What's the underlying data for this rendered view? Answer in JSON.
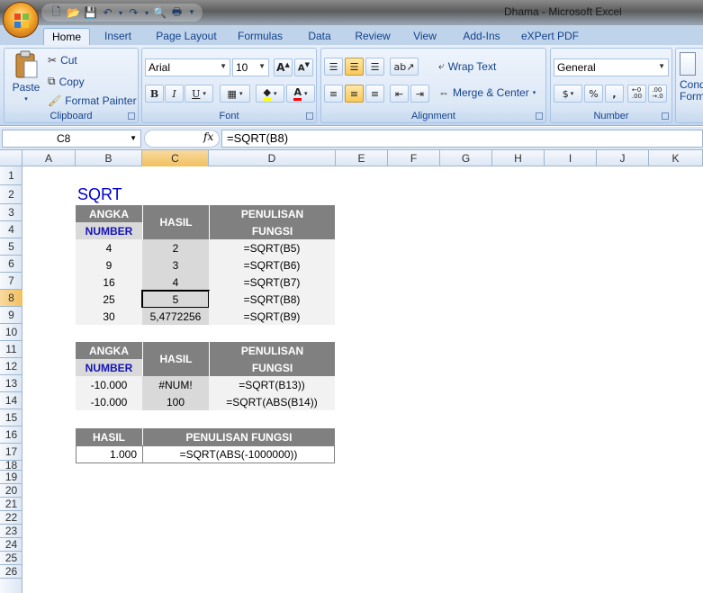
{
  "window": {
    "title": "Dhama - Microsoft Excel"
  },
  "tabs": [
    "Home",
    "Insert",
    "Page Layout",
    "Formulas",
    "Data",
    "Review",
    "View",
    "Add-Ins",
    "eXPert PDF"
  ],
  "clipboard": {
    "paste": "Paste",
    "cut": "Cut",
    "copy": "Copy",
    "format_painter": "Format Painter",
    "label": "Clipboard"
  },
  "font": {
    "name": "Arial",
    "size": "10",
    "label": "Font"
  },
  "alignment": {
    "wrap_text": "Wrap Text",
    "merge_center": "Merge & Center",
    "label": "Alignment"
  },
  "number": {
    "format": "General",
    "label": "Number",
    "percent": "%",
    "comma": ","
  },
  "styles": {
    "cond_line1": "Cond",
    "cond_line2": "Form"
  },
  "formula_bar": {
    "name_box": "C8",
    "fx": "fx",
    "formula": "=SQRT(B8)"
  },
  "columns": [
    "A",
    "B",
    "C",
    "D",
    "E",
    "F",
    "G",
    "H",
    "I",
    "J",
    "K"
  ],
  "rows": [
    "1",
    "2",
    "3",
    "4",
    "5",
    "6",
    "7",
    "8",
    "9",
    "10",
    "11",
    "12",
    "13",
    "14",
    "15",
    "16",
    "17",
    "18",
    "19",
    "20",
    "21",
    "22",
    "23",
    "24",
    "25",
    "26"
  ],
  "sheet": {
    "title": "SQRT",
    "table1": {
      "h_angka": "ANGKA",
      "h_number": "NUMBER",
      "h_hasil": "HASIL",
      "h_penulisan1": "PENULISAN",
      "h_penulisan2": "FUNGSI",
      "rows": [
        {
          "angka": "4",
          "hasil": "2",
          "fungsi": "=SQRT(B5)"
        },
        {
          "angka": "9",
          "hasil": "3",
          "fungsi": "=SQRT(B6)"
        },
        {
          "angka": "16",
          "hasil": "4",
          "fungsi": "=SQRT(B7)"
        },
        {
          "angka": "25",
          "hasil": "5",
          "fungsi": "=SQRT(B8)"
        },
        {
          "angka": "30",
          "hasil": "5,4772256",
          "fungsi": "=SQRT(B9)"
        }
      ]
    },
    "table2": {
      "h_angka": "ANGKA",
      "h_number": "NUMBER",
      "h_hasil": "HASIL",
      "h_penulisan1": "PENULISAN",
      "h_penulisan2": "FUNGSI",
      "rows": [
        {
          "angka": "-10.000",
          "hasil": "#NUM!",
          "fungsi": "=SQRT(B13))"
        },
        {
          "angka": "-10.000",
          "hasil": "100",
          "fungsi": "=SQRT(ABS(B14))"
        }
      ]
    },
    "table3": {
      "h_hasil": "HASIL",
      "h_penulisan": "PENULISAN FUNGSI",
      "hasil": "1.000",
      "fungsi": "=SQRT(ABS(-1000000))"
    }
  }
}
